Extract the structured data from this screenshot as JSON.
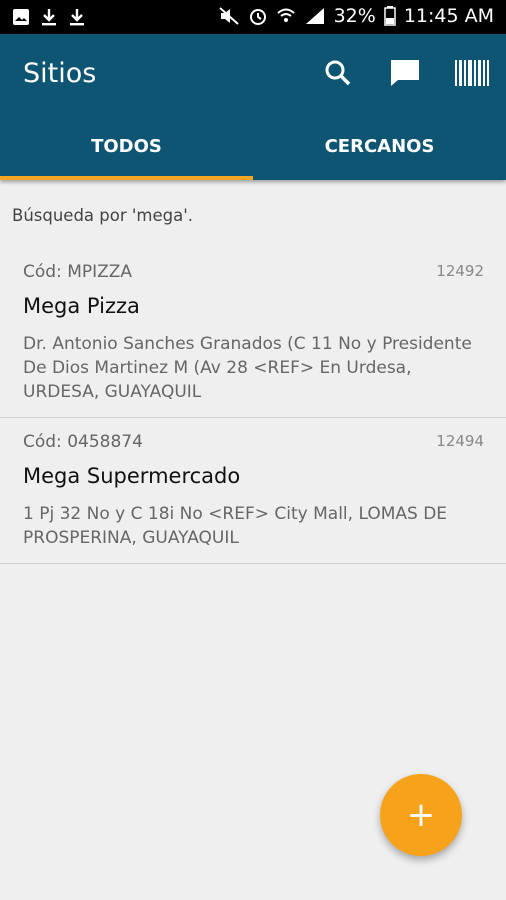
{
  "status_bar": {
    "battery": "32%",
    "time": "11:45 AM"
  },
  "app_bar": {
    "title": "Sitios"
  },
  "tabs": [
    {
      "label": "TODOS",
      "active": true
    },
    {
      "label": "CERCANOS",
      "active": false
    }
  ],
  "search_note": "Búsqueda por 'mega'.",
  "results": [
    {
      "code": "Cód: MPIZZA",
      "number": "12492",
      "name": "Mega Pizza",
      "address": "Dr. Antonio Sanches Granados (C 11 No y Presidente De Dios Martinez M (Av 28 <REF> En Urdesa, URDESA, GUAYAQUIL"
    },
    {
      "code": "Cód: 0458874",
      "number": "12494",
      "name": "Mega Supermercado",
      "address": "1 Pj 32 No y C 18i No <REF> City Mall, LOMAS DE PROSPERINA, GUAYAQUIL"
    }
  ],
  "fab": {
    "label": "+"
  },
  "colors": {
    "app_bar": "#0d5572",
    "accent": "#f7a21b",
    "tab_indicator": "#f5a623"
  }
}
